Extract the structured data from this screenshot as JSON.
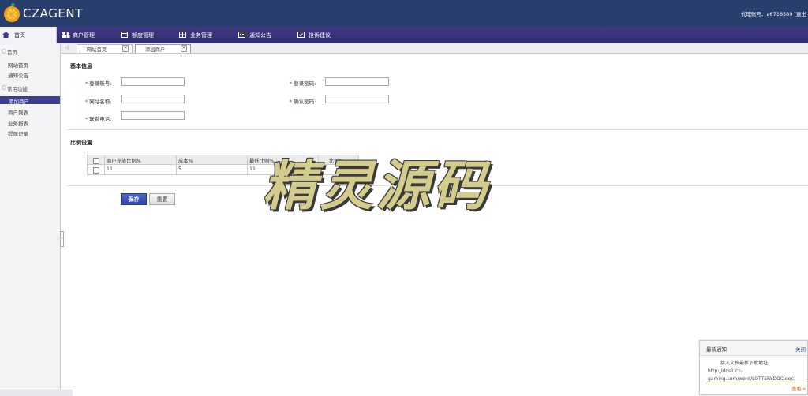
{
  "app": {
    "logo_text": "CZAGENT",
    "account_text": "代理账号、a6716589  [退出"
  },
  "nav": {
    "home": "首页",
    "items": [
      {
        "label": "商户管理",
        "icon": "users-icon"
      },
      {
        "label": "额度管理",
        "icon": "window-icon"
      },
      {
        "label": "业务管理",
        "icon": "grid-icon"
      },
      {
        "label": "通知公告",
        "icon": "calendar-icon"
      },
      {
        "label": "投诉建议",
        "icon": "feedback-icon"
      }
    ]
  },
  "sidebar": {
    "group1": "首页",
    "group1_items": [
      "网站首页",
      "通知公告"
    ],
    "group2": "常用功能",
    "group2_items": [
      "添加商户",
      "商户列表",
      "业务报表",
      "提现记录"
    ],
    "active": "添加商户"
  },
  "tabs": [
    "网站首页",
    "添加商户"
  ],
  "form": {
    "basic_title": "基本信息",
    "labels": {
      "login_account": "登录账号:",
      "login_password": "登录密码:",
      "site_name": "网站名称:",
      "confirm_password": "确认密码:",
      "phone": "联系电话:"
    },
    "ratio_title": "比例设置",
    "grid_headers": [
      "商户充值比例%",
      "成本%",
      "最低比例%",
      "比例%"
    ],
    "grid_row": [
      "11",
      "5",
      "11",
      ""
    ],
    "save_label": "保存",
    "reset_label": "重置"
  },
  "watermark": "精灵源码",
  "notice": {
    "title": "最新通知",
    "close": "关闭",
    "body": "接入文档最新下载地址、http://dns1.cz-gaming.com/word/LOTTERYDOC.doc",
    "more": "查看 »"
  },
  "colors": {
    "topbar": "#283e6d",
    "navbar": "#3a3680",
    "active": "#3b3f8a",
    "save": "#3a52b8"
  }
}
